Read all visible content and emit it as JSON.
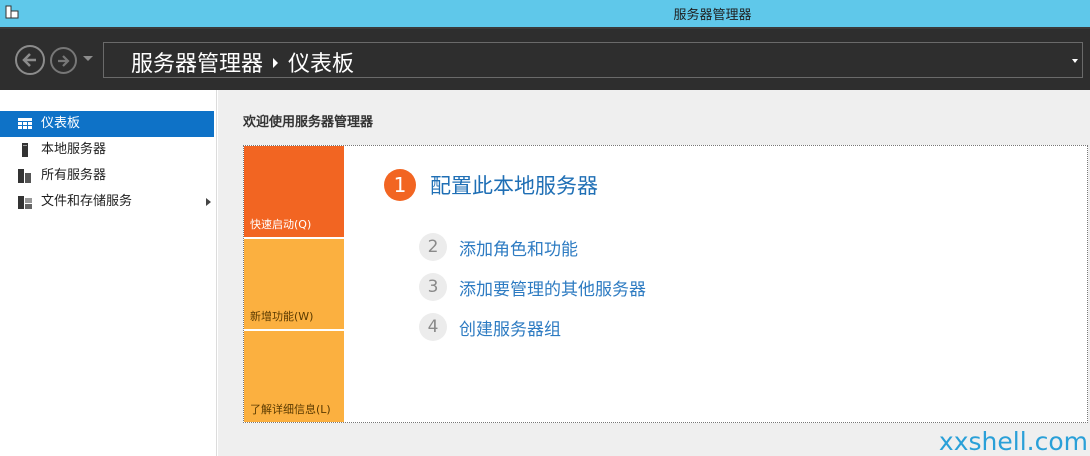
{
  "window": {
    "title": "服务器管理器"
  },
  "breadcrumb": {
    "root": "服务器管理器",
    "current": "仪表板"
  },
  "sidebar": {
    "items": [
      {
        "label": "仪表板",
        "icon": "dashboard-icon",
        "active": true
      },
      {
        "label": "本地服务器",
        "icon": "server-icon",
        "active": false
      },
      {
        "label": "所有服务器",
        "icon": "servers-icon",
        "active": false
      },
      {
        "label": "文件和存储服务",
        "icon": "file-storage-icon",
        "active": false
      }
    ]
  },
  "main": {
    "welcome": "欢迎使用服务器管理器",
    "tiles": [
      {
        "label": "快速启动(Q)",
        "color": "#f26522"
      },
      {
        "label": "新增功能(W)",
        "color": "#fbb040"
      },
      {
        "label": "了解详细信息(L)",
        "color": "#fbb040"
      }
    ],
    "steps": [
      {
        "num": "1",
        "label": "配置此本地服务器"
      },
      {
        "num": "2",
        "label": "添加角色和功能"
      },
      {
        "num": "3",
        "label": "添加要管理的其他服务器"
      },
      {
        "num": "4",
        "label": "创建服务器组"
      }
    ]
  },
  "watermark": "xxshell.com",
  "colors": {
    "accent": "#0e72c7",
    "orange": "#f26522",
    "amber": "#fbb040",
    "titlebar": "#5fc8ea",
    "navbar": "#2e2e2e"
  }
}
